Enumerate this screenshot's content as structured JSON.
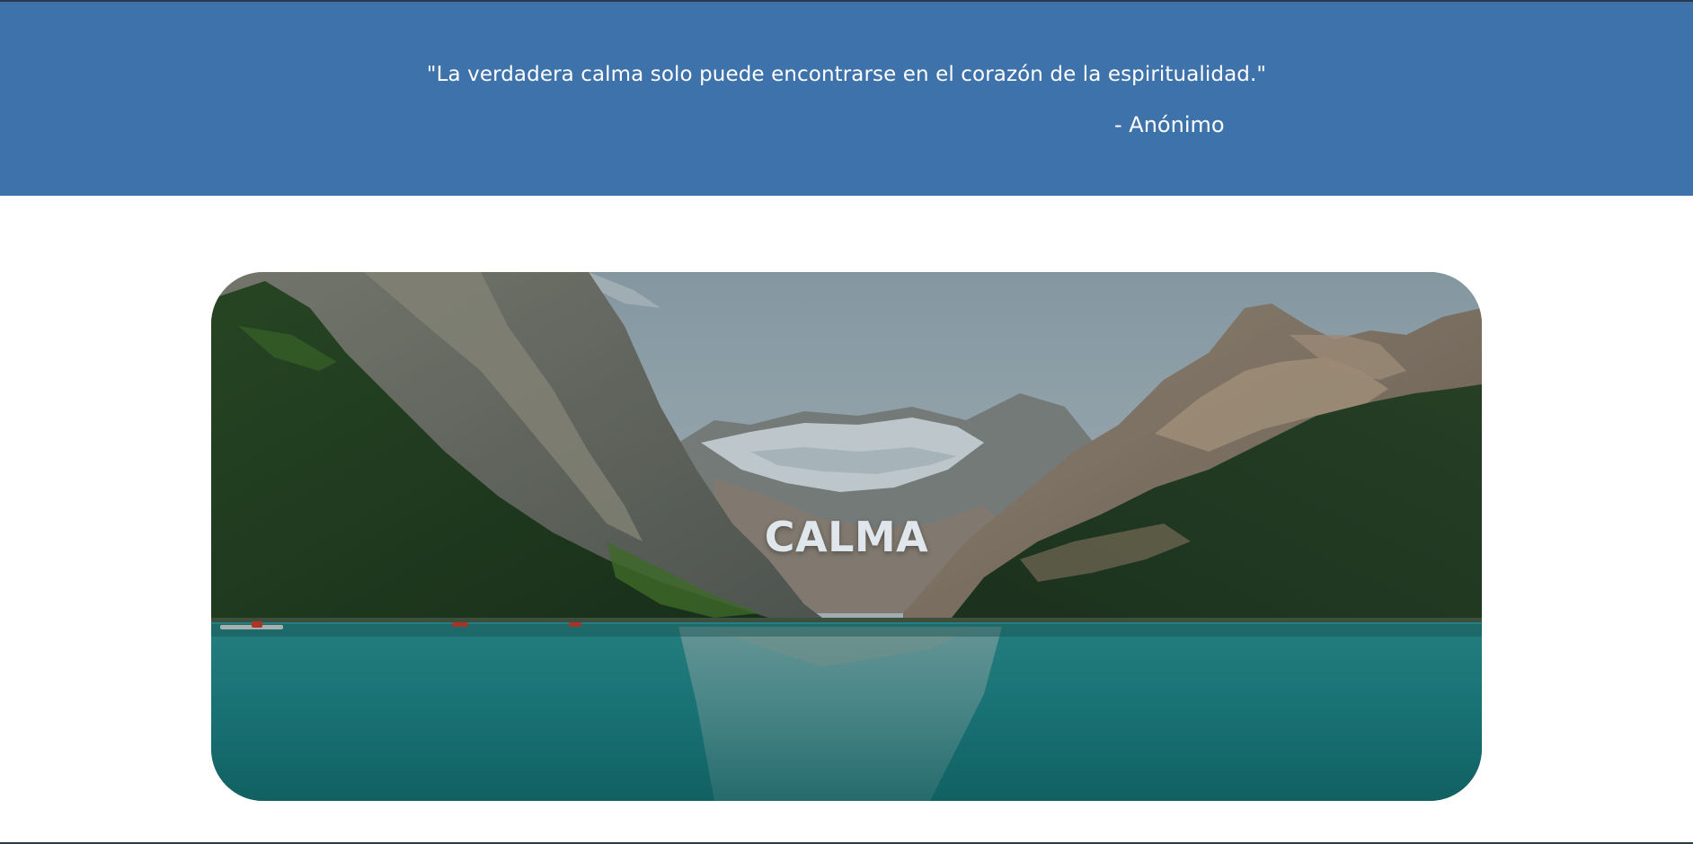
{
  "quote": {
    "text": "\"La verdadera calma solo puede encontrarse en el corazón de la espiritualidad.\"",
    "author": "- Anónimo"
  },
  "hero": {
    "title": "CALMA",
    "image_alt": "mountain-lake-landscape"
  },
  "colors": {
    "banner_bg": "#3e72ab",
    "banner_text": "#ffffff",
    "page_bg": "#ffffff",
    "hero_title": "#dfe6ec",
    "lake": "#1f8a8c",
    "forest": "#1c3b1c"
  }
}
